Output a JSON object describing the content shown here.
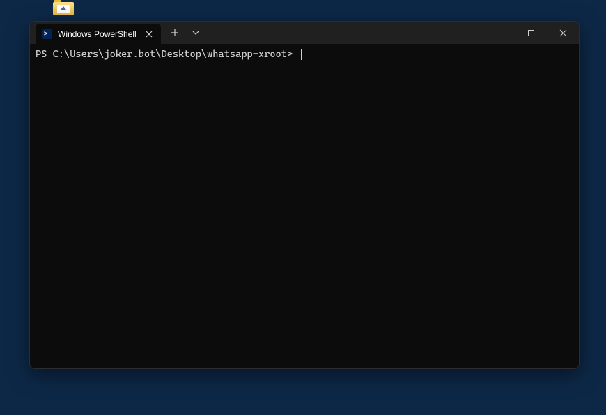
{
  "desktop": {
    "folder_name": "folder"
  },
  "window": {
    "tabs": [
      {
        "title": "Windows PowerShell",
        "icon": ">_"
      }
    ],
    "prompt": "PS C:\\Users\\joker.bot\\Desktop\\whatsapp-xroot> ",
    "input": ""
  }
}
